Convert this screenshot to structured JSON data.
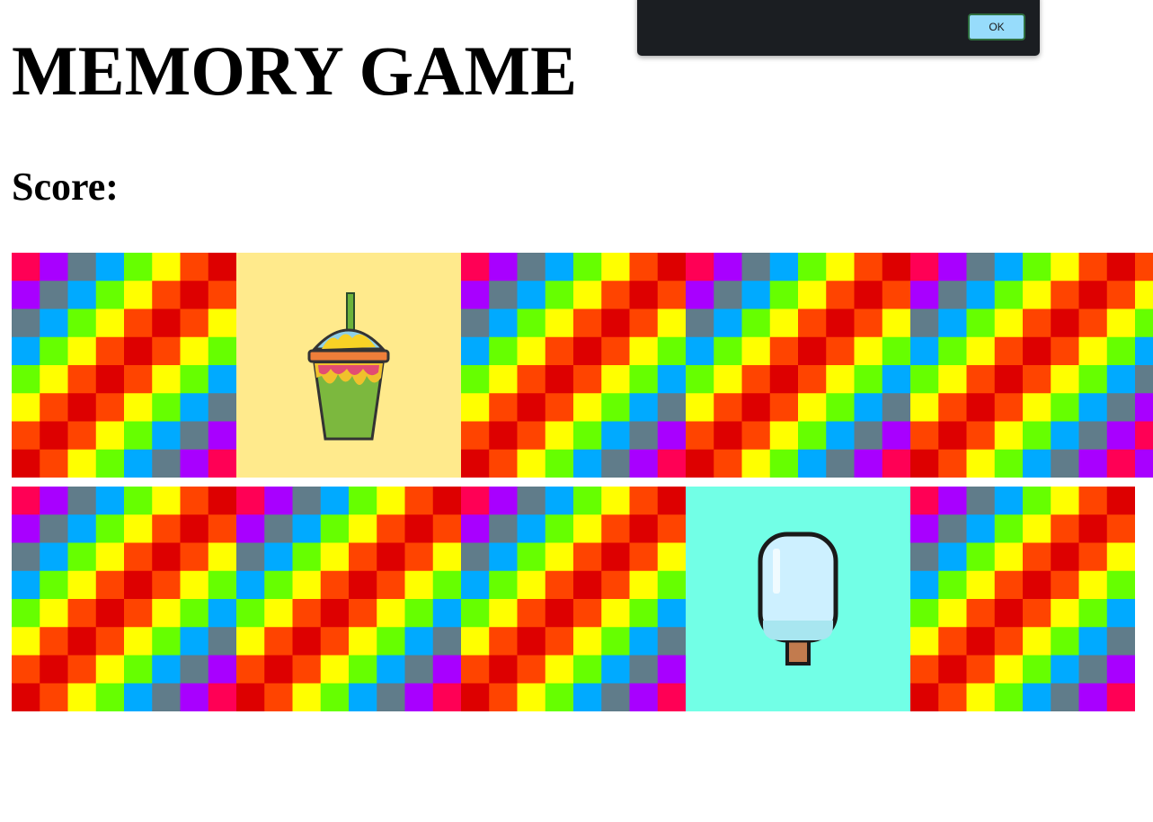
{
  "title": "MEMORY GAME",
  "score_label": "Score:",
  "dialog": {
    "ok_label": "OK"
  },
  "card_back_palette": [
    "#ff0055",
    "#a800ff",
    "#607c8a",
    "#00aaff",
    "#66ff00",
    "#ffff00",
    "#ff4400",
    "#dd0000"
  ],
  "cards": [
    {
      "state": "back"
    },
    {
      "state": "face",
      "icon": "slushie-cup-icon",
      "face_color": "#ffea8c"
    },
    {
      "state": "back"
    },
    {
      "state": "back"
    },
    {
      "state": "back"
    },
    {
      "state": "back"
    },
    {
      "state": "back"
    },
    {
      "state": "back"
    },
    {
      "state": "face",
      "icon": "popsicle-icon",
      "face_color": "#72ffe6"
    },
    {
      "state": "back"
    }
  ]
}
